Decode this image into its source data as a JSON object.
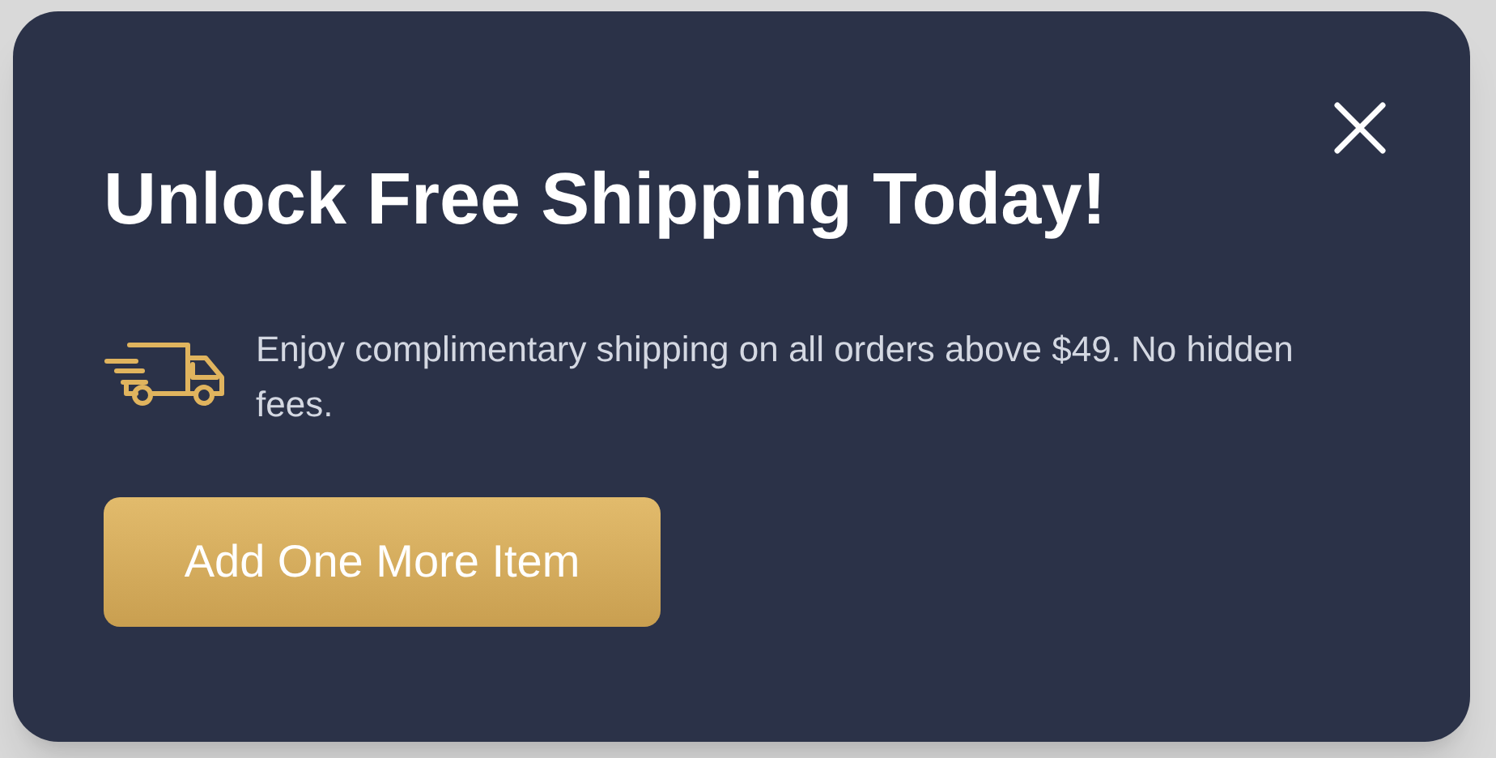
{
  "dialog": {
    "title": "Unlock Free Shipping Today!",
    "message": "Enjoy complimentary shipping on all orders above $49. No hidden fees.",
    "button": "Add One More Item"
  }
}
